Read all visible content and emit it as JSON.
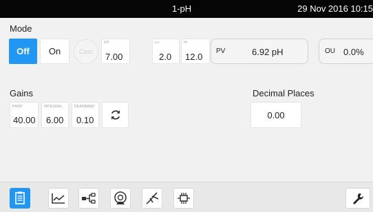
{
  "topbar": {
    "title": "1-pH",
    "datetime": "29 Nov 2016 10:15"
  },
  "mode": {
    "label": "Mode",
    "off_label": "Off",
    "on_label": "On",
    "cascade_label": "Casc",
    "sp": {
      "label": "SP",
      "value": "7.00"
    },
    "lo": {
      "label": "Lo",
      "value": "2.0"
    },
    "hi": {
      "label": "Hi",
      "value": "12.0"
    },
    "pv": {
      "label": "PV",
      "value": "6.92 pH"
    },
    "ou": {
      "label": "OU",
      "value": "0.0%"
    }
  },
  "gains": {
    "label": "Gains",
    "prop": {
      "label": "PROP",
      "value": "40.00"
    },
    "integral": {
      "label": "INTEGRAL",
      "value": "6.00"
    },
    "deadband": {
      "label": "DEADBAND",
      "value": "0.10"
    },
    "refresh_icon": "refresh-icon"
  },
  "decimal_places": {
    "label": "Decimal Places",
    "value": "0.00"
  },
  "toolbar": {
    "items": [
      "clipboard-icon",
      "trend-chart-icon",
      "network-icon",
      "pump-icon",
      "probe-icon",
      "chip-icon"
    ],
    "settings_icon": "wrench-icon"
  },
  "colors": {
    "accent": "#2196f3",
    "topbar": "#050505",
    "background": "#f1f1f1"
  }
}
